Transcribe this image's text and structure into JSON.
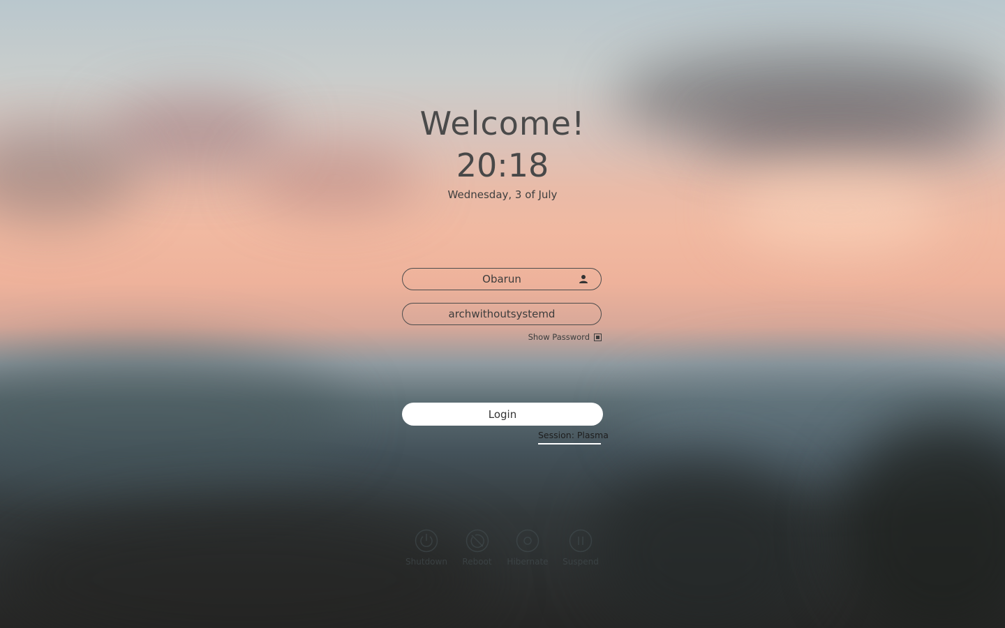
{
  "greeting": {
    "title": "Welcome!",
    "time": "20:18",
    "date": "Wednesday, 3 of July"
  },
  "login_form": {
    "username": "Obarun",
    "password": "archwithoutsystemd",
    "show_password_label": "Show Password",
    "show_password_checked": true,
    "login_label": "Login",
    "session_label": "Session: Plasma"
  },
  "power_actions": [
    {
      "label": "Shutdown",
      "icon": "power-icon"
    },
    {
      "label": "Reboot",
      "icon": "reboot-icon"
    },
    {
      "label": "Hibernate",
      "icon": "hibernate-icon"
    },
    {
      "label": "Suspend",
      "icon": "suspend-icon"
    }
  ],
  "colors": {
    "field_border": "#4c4c4c",
    "login_button_bg": "#ffffff",
    "session_underline": "#ffffff"
  }
}
